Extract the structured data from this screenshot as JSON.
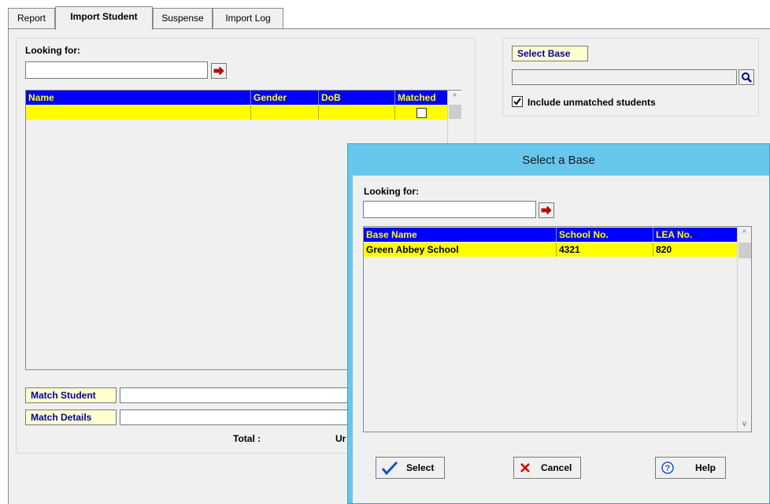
{
  "tabs": [
    {
      "label": "Report"
    },
    {
      "label": "Import Student"
    },
    {
      "label": "Suspense"
    },
    {
      "label": "Import Log"
    }
  ],
  "left": {
    "looking_for_label": "Looking for:",
    "search_value": "",
    "grid": {
      "columns": [
        "Name",
        "Gender",
        "DoB",
        "Matched"
      ],
      "rows": [
        {
          "name": "",
          "gender": "",
          "dob": "",
          "matched": false
        }
      ]
    },
    "match_student_label": "Match Student",
    "match_details_label": "Match Details",
    "total_label": "Total :",
    "unmatched_label_partial": "Ur"
  },
  "right": {
    "select_base_label": "Select Base",
    "base_value": "",
    "include_unmatched_label": "Include unmatched students",
    "include_unmatched_checked": true
  },
  "dialog": {
    "title": "Select a Base",
    "looking_for_label": "Looking for:",
    "search_value": "",
    "columns": [
      "Base Name",
      "School No.",
      "LEA No."
    ],
    "rows": [
      {
        "base_name": "Green Abbey School",
        "school_no": "4321",
        "lea_no": "820"
      }
    ],
    "buttons": {
      "select": "Select",
      "cancel": "Cancel",
      "help": "Help"
    }
  },
  "colors": {
    "grid_header_bg": "#0000ff",
    "grid_header_text": "#ffff00",
    "grid_row_bg": "#ffff00",
    "dialog_titlebar": "#67c6eb",
    "label_text": "#0000a0"
  }
}
